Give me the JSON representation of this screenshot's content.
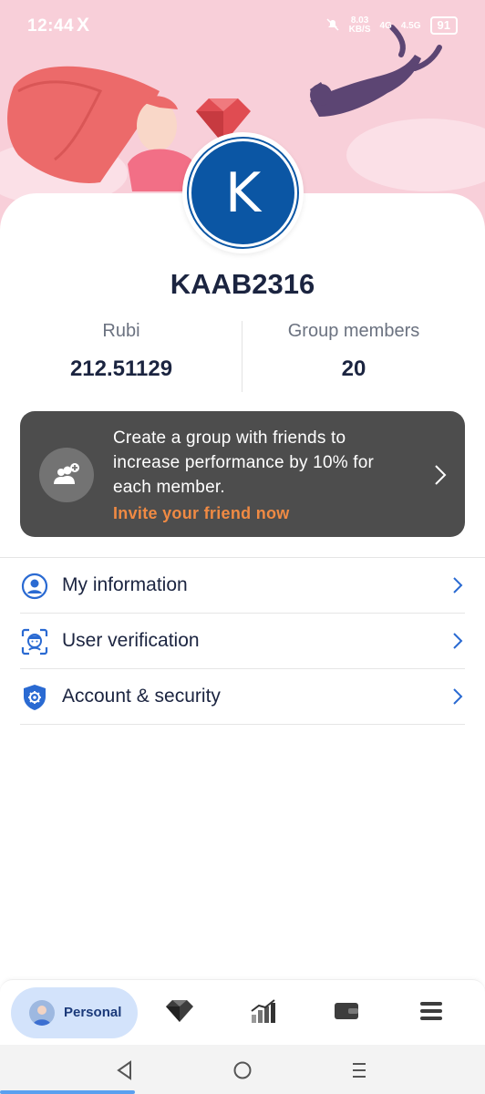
{
  "status_bar": {
    "time": "12:44",
    "x_label": "X",
    "net_speed": "8.03",
    "net_unit": "KB/S",
    "signal1": "4G",
    "signal2": "4.5G",
    "battery": "91"
  },
  "profile": {
    "avatar_letter": "K",
    "username": "KAAB2316"
  },
  "stats": {
    "rubi": {
      "label": "Rubi",
      "value": "212.51129"
    },
    "group": {
      "label": "Group members",
      "value": "20"
    }
  },
  "invite": {
    "text": "Create a group with friends to increase performance by 10% for each member.",
    "link": "Invite your friend now"
  },
  "menu": [
    {
      "label": "My information",
      "icon": "user-circle-icon"
    },
    {
      "label": "User verification",
      "icon": "face-scan-icon"
    },
    {
      "label": "Account & security",
      "icon": "shield-gear-icon"
    }
  ],
  "bottom_nav": {
    "personal_label": "Personal",
    "items": [
      "gem-icon",
      "chart-icon",
      "wallet-icon",
      "menu-icon"
    ]
  },
  "colors": {
    "accent": "#0b56a4",
    "hero": "#f8cfd9",
    "banner": "#4d4d4d",
    "invite_link": "#f08a43",
    "menu_icon": "#2a6ad2"
  }
}
